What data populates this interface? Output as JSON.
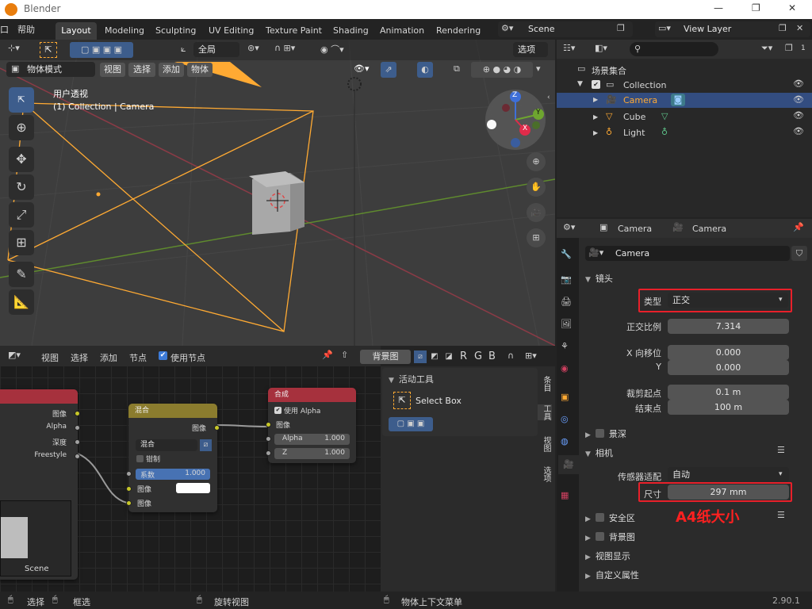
{
  "titlebar": {
    "app_name": "Blender",
    "minimize": "—",
    "maximize": "❐",
    "close": "✕"
  },
  "menubar": {
    "file_cut": "口",
    "help": "帮助",
    "workspaces": [
      "Layout",
      "Modeling",
      "Sculpting",
      "UV Editing",
      "Texture Paint",
      "Shading",
      "Animation",
      "Rendering"
    ],
    "scene_value": "Scene",
    "view_layer_value": "View Layer"
  },
  "viewport": {
    "transform_orientation": "全局",
    "options_label": "选项",
    "mode_value": "物体模式",
    "menus": [
      "视图",
      "选择",
      "添加",
      "物体"
    ],
    "view_name": "用户透视",
    "collection_info": "(1) Collection | Camera",
    "gizmo": {
      "z": "Z",
      "y": "Y",
      "x": "X"
    }
  },
  "node_editor": {
    "menus": [
      "视图",
      "选择",
      "添加",
      "节点"
    ],
    "use_nodes_label": "使用节点",
    "backdrop_label": "背景图",
    "channels": [
      "R",
      "G",
      "B"
    ],
    "render_layers": {
      "outputs": [
        "图像",
        "Alpha",
        "深度",
        "Freestyle"
      ],
      "scene_label": "Scene"
    },
    "mix_node": {
      "title": "混合",
      "output": "图像",
      "blend_value": "混合",
      "clamp_label": "钳制",
      "factor_label": "系数",
      "factor_value": "1.000",
      "input1": "图像",
      "input2": "图像"
    },
    "composite_node": {
      "title": "合成",
      "use_alpha": "使用 Alpha",
      "input_image": "图像",
      "alpha_label": "Alpha",
      "alpha_value": "1.000",
      "z_label": "Z",
      "z_value": "1.000"
    },
    "sidebar": {
      "section": "活动工具",
      "tool_name": "Select Box",
      "tabs": [
        "条目",
        "工具",
        "视图",
        "选项"
      ]
    }
  },
  "outliner": {
    "search_placeholder": "",
    "filter_count": "1",
    "root": "场景集合",
    "items": [
      {
        "name": "Collection"
      },
      {
        "name": "Camera"
      },
      {
        "name": "Cube"
      },
      {
        "name": "Light"
      }
    ]
  },
  "properties": {
    "crumb_object": "Camera",
    "crumb_data": "Camera",
    "data_name": "Camera",
    "lens_section": "镜头",
    "type_label": "类型",
    "type_value": "正交",
    "ortho_scale_label": "正交比例",
    "ortho_scale_value": "7.314",
    "shift_x_label": "X 向移位",
    "shift_x_value": "0.000",
    "shift_y_label": "Y",
    "shift_y_value": "0.000",
    "clip_start_label": "裁剪起点",
    "clip_start_value": "0.1 m",
    "clip_end_label": "结束点",
    "clip_end_value": "100 m",
    "dof_section": "景深",
    "camera_section": "相机",
    "sensor_fit_label": "传感器适配",
    "sensor_fit_value": "自动",
    "size_label": "尺寸",
    "size_value": "297 mm",
    "annotation": "A4纸大小",
    "safe_areas_section": "安全区",
    "background_section": "背景图",
    "viewport_display_section": "视图显示",
    "custom_props_section": "自定义属性"
  },
  "statusbar": {
    "select": "选择",
    "box_select": "框选",
    "rotate_view": "旋转视图",
    "context_menu": "物体上下文菜单",
    "version": "2.90.1"
  },
  "colors": {
    "accent_blue": "#3d5d8c",
    "highlight_red": "#e8202a",
    "annotation_red": "#ff2020",
    "camera_orange": "#ffaa33",
    "node_red_header": "#a6313d",
    "node_yellow_header": "#8b7c2e",
    "outliner_selected": "#334d80"
  }
}
